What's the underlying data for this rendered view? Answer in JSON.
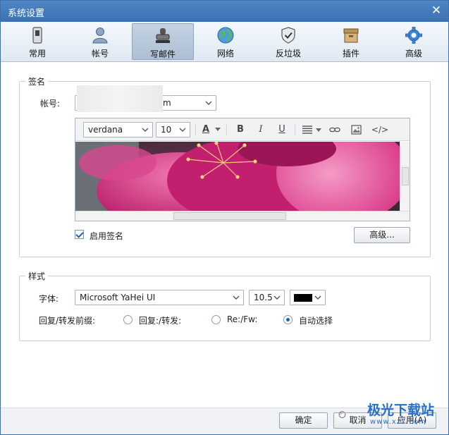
{
  "window": {
    "title": "系统设置"
  },
  "tabs": [
    {
      "label": "常用",
      "icon": "switch-icon"
    },
    {
      "label": "帐号",
      "icon": "person-icon"
    },
    {
      "label": "写邮件",
      "icon": "stamp-icon"
    },
    {
      "label": "网络",
      "icon": "globe-icon"
    },
    {
      "label": "反垃圾",
      "icon": "shield-icon"
    },
    {
      "label": "插件",
      "icon": "box-icon"
    },
    {
      "label": "高级",
      "icon": "gear-icon"
    }
  ],
  "active_tab": "写邮件",
  "signature": {
    "group_title": "签名",
    "account_label": "帐号:",
    "account_value": "m",
    "editor": {
      "font_family": "verdana",
      "font_size": "10",
      "tools": [
        "A",
        "B",
        "I",
        "U"
      ],
      "code_label": "</>"
    },
    "enable_label": "启用签名",
    "enabled": true,
    "advanced_button": "高级..."
  },
  "style": {
    "group_title": "样式",
    "font_label": "字体:",
    "font_value": "Microsoft YaHei UI",
    "size_value": "10.5",
    "color_value": "#000000",
    "prefix_label": "回复/转发前缀:",
    "prefix_options": [
      "回复:/转发:",
      "Re:/Fw:",
      "自动选择"
    ],
    "prefix_selected": 2
  },
  "footer": {
    "ok": "确定",
    "cancel": "取消",
    "apply": "应用(A)"
  },
  "watermark": {
    "text": "极光下载站",
    "sub": "www.xz7.com"
  },
  "colors": {
    "accent": "#3b71b3",
    "pink": "#d42a7d"
  }
}
